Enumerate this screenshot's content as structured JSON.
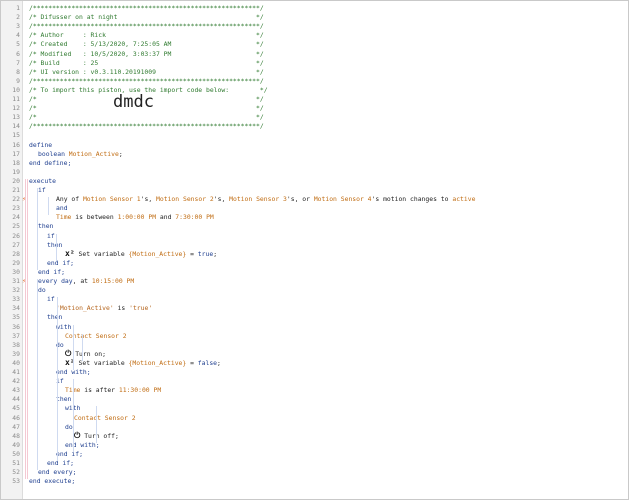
{
  "lines": [
    {
      "n": "1",
      "segs": [
        {
          "t": "/***********************************************************/",
          "c": "comment"
        }
      ]
    },
    {
      "n": "2",
      "segs": [
        {
          "t": "/* Difusser on at night                                    */",
          "c": "comment"
        }
      ]
    },
    {
      "n": "3",
      "segs": [
        {
          "t": "/***********************************************************/",
          "c": "comment"
        }
      ]
    },
    {
      "n": "4",
      "segs": [
        {
          "t": "/* Author     : Rick                                       */",
          "c": "comment"
        }
      ]
    },
    {
      "n": "5",
      "segs": [
        {
          "t": "/* Created    : 5/13/2020, 7:25:05 AM                      */",
          "c": "comment"
        }
      ]
    },
    {
      "n": "6",
      "segs": [
        {
          "t": "/* Modified   : 10/5/2020, 3:03:37 PM                      */",
          "c": "comment"
        }
      ]
    },
    {
      "n": "7",
      "segs": [
        {
          "t": "/* Build      : 25                                         */",
          "c": "comment"
        }
      ]
    },
    {
      "n": "8",
      "segs": [
        {
          "t": "/* UI version : v0.3.110.20191009                          */",
          "c": "comment"
        }
      ]
    },
    {
      "n": "9",
      "segs": [
        {
          "t": "/***********************************************************/",
          "c": "comment"
        }
      ]
    },
    {
      "n": "10",
      "segs": [
        {
          "t": "/* To import this piston, use the import code below:        */",
          "c": "comment"
        }
      ]
    },
    {
      "n": "11",
      "segs": [
        {
          "t": "/*                                                         */",
          "c": "comment"
        }
      ]
    },
    {
      "n": "12",
      "segs": [
        {
          "t": "/*                                                         */",
          "c": "comment"
        }
      ],
      "big": "dmdc"
    },
    {
      "n": "13",
      "segs": [
        {
          "t": "/*                                                         */",
          "c": "comment"
        }
      ]
    },
    {
      "n": "14",
      "segs": [
        {
          "t": "/***********************************************************/",
          "c": "comment"
        }
      ]
    },
    {
      "n": "15",
      "segs": []
    },
    {
      "n": "16",
      "segs": [
        {
          "t": "define",
          "c": "kw"
        }
      ]
    },
    {
      "n": "17",
      "indent": 1,
      "segs": [
        {
          "t": "boolean ",
          "c": "type"
        },
        {
          "t": "Motion_Active",
          "c": "var"
        },
        {
          "t": ";",
          "c": "text"
        }
      ]
    },
    {
      "n": "18",
      "segs": [
        {
          "t": "end define;",
          "c": "kw"
        }
      ]
    },
    {
      "n": "19",
      "segs": []
    },
    {
      "n": "20",
      "segs": [
        {
          "t": "execute",
          "c": "kw"
        }
      ]
    },
    {
      "n": "21",
      "indent": 1,
      "segs": [
        {
          "t": "if",
          "c": "kw"
        }
      ]
    },
    {
      "n": "22",
      "indent": 3,
      "mark": "⚡",
      "segs": [
        {
          "t": "Any of ",
          "c": "text"
        },
        {
          "t": "Motion Sensor 1",
          "c": "dev"
        },
        {
          "t": "'s, ",
          "c": "text"
        },
        {
          "t": "Motion Sensor 2",
          "c": "dev"
        },
        {
          "t": "'s, ",
          "c": "text"
        },
        {
          "t": "Motion Sensor 3",
          "c": "dev"
        },
        {
          "t": "'s, or ",
          "c": "text"
        },
        {
          "t": "Motion Sensor 4",
          "c": "dev"
        },
        {
          "t": "'s motion changes to ",
          "c": "text"
        },
        {
          "t": "active",
          "c": "val"
        }
      ]
    },
    {
      "n": "23",
      "indent": 3,
      "segs": [
        {
          "t": "and",
          "c": "kw"
        }
      ]
    },
    {
      "n": "24",
      "indent": 3,
      "segs": [
        {
          "t": "Time",
          "c": "dev"
        },
        {
          "t": " is between ",
          "c": "text"
        },
        {
          "t": "1:00:00 PM",
          "c": "val"
        },
        {
          "t": " and ",
          "c": "text"
        },
        {
          "t": "7:30:00 PM",
          "c": "val"
        }
      ]
    },
    {
      "n": "25",
      "indent": 1,
      "segs": [
        {
          "t": "then",
          "c": "kw"
        }
      ]
    },
    {
      "n": "26",
      "indent": 2,
      "segs": [
        {
          "t": "if",
          "c": "kw"
        }
      ]
    },
    {
      "n": "27",
      "indent": 2,
      "segs": [
        {
          "t": "then",
          "c": "kw"
        }
      ]
    },
    {
      "n": "28",
      "indent": 4,
      "icon": "x²",
      "segs": [
        {
          "t": "Set variable ",
          "c": "text"
        },
        {
          "t": "{Motion_Active}",
          "c": "var"
        },
        {
          "t": " = ",
          "c": "text"
        },
        {
          "t": "true",
          "c": "kw"
        },
        {
          "t": ";",
          "c": "text"
        }
      ]
    },
    {
      "n": "29",
      "indent": 2,
      "segs": [
        {
          "t": "end if;",
          "c": "kw"
        }
      ]
    },
    {
      "n": "30",
      "indent": 1,
      "segs": [
        {
          "t": "end if;",
          "c": "kw"
        }
      ]
    },
    {
      "n": "31",
      "indent": 1,
      "mark": "⚡",
      "segs": [
        {
          "t": "every day",
          "c": "kw"
        },
        {
          "t": ", at ",
          "c": "text"
        },
        {
          "t": "10:15:00 PM",
          "c": "val"
        }
      ]
    },
    {
      "n": "32",
      "indent": 1,
      "segs": [
        {
          "t": "do",
          "c": "kw"
        }
      ]
    },
    {
      "n": "33",
      "indent": 2,
      "segs": [
        {
          "t": "if",
          "c": "kw"
        }
      ]
    },
    {
      "n": "34",
      "indent": 3,
      "segs": [
        {
          "t": "'Motion_Active'",
          "c": "str"
        },
        {
          "t": " is ",
          "c": "text"
        },
        {
          "t": "'true'",
          "c": "str"
        }
      ]
    },
    {
      "n": "35",
      "indent": 2,
      "segs": [
        {
          "t": "then",
          "c": "kw"
        }
      ]
    },
    {
      "n": "36",
      "indent": 3,
      "segs": [
        {
          "t": "with",
          "c": "kw"
        }
      ]
    },
    {
      "n": "37",
      "indent": 4,
      "segs": [
        {
          "t": "Contact Sensor 2",
          "c": "dev"
        }
      ]
    },
    {
      "n": "38",
      "indent": 3,
      "segs": [
        {
          "t": "do",
          "c": "kw"
        }
      ]
    },
    {
      "n": "39",
      "indent": 4,
      "icon": "⏻",
      "segs": [
        {
          "t": "Turn on;",
          "c": "text"
        }
      ]
    },
    {
      "n": "40",
      "indent": 4,
      "icon": "x²",
      "segs": [
        {
          "t": "Set variable ",
          "c": "text"
        },
        {
          "t": "{Motion_Active}",
          "c": "var"
        },
        {
          "t": " = ",
          "c": "text"
        },
        {
          "t": "false",
          "c": "kw"
        },
        {
          "t": ";",
          "c": "text"
        }
      ]
    },
    {
      "n": "41",
      "indent": 3,
      "segs": [
        {
          "t": "end with;",
          "c": "kw"
        }
      ]
    },
    {
      "n": "42",
      "indent": 3,
      "segs": [
        {
          "t": "if",
          "c": "kw"
        }
      ]
    },
    {
      "n": "43",
      "indent": 4,
      "segs": [
        {
          "t": "Time",
          "c": "dev"
        },
        {
          "t": " is after ",
          "c": "text"
        },
        {
          "t": "11:30:00 PM",
          "c": "val"
        }
      ]
    },
    {
      "n": "44",
      "indent": 3,
      "segs": [
        {
          "t": "then",
          "c": "kw"
        }
      ]
    },
    {
      "n": "45",
      "indent": 4,
      "segs": [
        {
          "t": "with",
          "c": "kw"
        }
      ]
    },
    {
      "n": "46",
      "indent": 5,
      "segs": [
        {
          "t": "Contact Sensor 2",
          "c": "dev"
        }
      ]
    },
    {
      "n": "47",
      "indent": 4,
      "segs": [
        {
          "t": "do",
          "c": "kw"
        }
      ]
    },
    {
      "n": "48",
      "indent": 5,
      "icon": "⏻",
      "segs": [
        {
          "t": "Turn off;",
          "c": "text"
        }
      ]
    },
    {
      "n": "49",
      "indent": 4,
      "segs": [
        {
          "t": "end with;",
          "c": "kw"
        }
      ]
    },
    {
      "n": "50",
      "indent": 3,
      "segs": [
        {
          "t": "end if;",
          "c": "kw"
        }
      ]
    },
    {
      "n": "51",
      "indent": 2,
      "segs": [
        {
          "t": "end if;",
          "c": "kw"
        }
      ]
    },
    {
      "n": "52",
      "indent": 1,
      "segs": [
        {
          "t": "end every;",
          "c": "kw"
        }
      ]
    },
    {
      "n": "53",
      "segs": [
        {
          "t": "end execute;",
          "c": "kw"
        }
      ]
    }
  ],
  "colors": {
    "comment": "#2f7a2f",
    "keyword": "#1f3f8f",
    "device": "#c06c12",
    "string": "#b5651d",
    "gutter": "#f2f2f2"
  }
}
